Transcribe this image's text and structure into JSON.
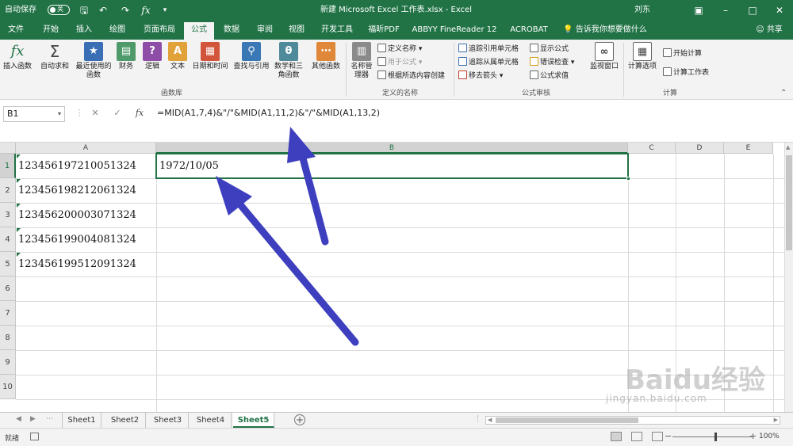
{
  "titlebar": {
    "autosave_label": "自动保存",
    "autosave_state": "关",
    "title": "新建 Microsoft Excel 工作表.xlsx - Excel",
    "user": "刘东",
    "qat": [
      "save-icon",
      "undo-icon",
      "redo-icon",
      "fx-icon",
      "customize-icon"
    ]
  },
  "tabs": [
    "文件",
    "开始",
    "插入",
    "绘图",
    "页面布局",
    "公式",
    "数据",
    "审阅",
    "视图",
    "开发工具",
    "福昕PDF",
    "ABBYY FineReader 12",
    "ACROBAT"
  ],
  "active_tab": "公式",
  "tell_me": "告诉我你想要做什么",
  "share": "共享",
  "ribbon": {
    "function_library": {
      "group_label": "函数库",
      "buttons": [
        "插入函数",
        "自动求和",
        "最近使用的函数",
        "财务",
        "逻辑",
        "文本",
        "日期和时间",
        "查找与引用",
        "数学和三角函数",
        "其他函数"
      ]
    },
    "defined_names": {
      "group_label": "定义的名称",
      "name_manager": "名称管理器",
      "items": [
        "定义名称",
        "用于公式",
        "根据所选内容创建"
      ]
    },
    "formula_auditing": {
      "group_label": "公式审核",
      "items": [
        "追踪引用单元格",
        "追踪从属单元格",
        "移去箭头",
        "显示公式",
        "错误检查",
        "公式求值"
      ],
      "watch_window": "监视窗口"
    },
    "calculation": {
      "group_label": "计算",
      "options": "计算选项",
      "items": [
        "开始计算",
        "计算工作表"
      ]
    }
  },
  "formula_bar": {
    "name_box": "B1",
    "formula": "=MID(A1,7,4)&\"/\"&MID(A1,11,2)&\"/\"&MID(A1,13,2)"
  },
  "grid": {
    "columns": [
      "A",
      "B",
      "C",
      "D",
      "E"
    ],
    "rows": [
      "1",
      "2",
      "3",
      "4",
      "5",
      "6",
      "7",
      "8",
      "9",
      "10"
    ],
    "cells": {
      "A1": "123456197210051324",
      "A2": "123456198212061324",
      "A3": "123456200003071324",
      "A4": "123456199004081324",
      "A5": "123456199512091324",
      "B1": "1972/10/05"
    },
    "selected": "B1"
  },
  "sheets": [
    "Sheet1",
    "Sheet2",
    "Sheet3",
    "Sheet4",
    "Sheet5"
  ],
  "active_sheet": "Sheet5",
  "status": {
    "ready": "就绪",
    "zoom": "100%"
  },
  "colors": {
    "excel_green": "#217346",
    "arrow_blue": "#3d3fbf"
  },
  "watermark": {
    "text": "Baidu经验",
    "sub": "jingyan.baidu.com"
  }
}
